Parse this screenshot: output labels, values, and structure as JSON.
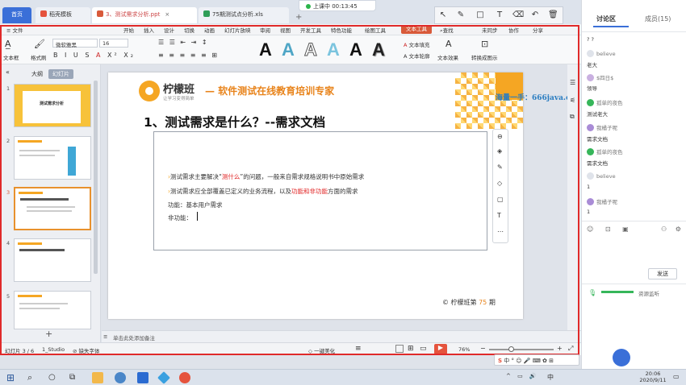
{
  "tabs": {
    "home": "首页",
    "docer": "稻壳模板",
    "ppt": "3、测试需求分析.ppt",
    "xls": "75期测试点分析.xls",
    "add": "+"
  },
  "timer": "上课中 00:13:45",
  "menu": {
    "file": "≡ 文件",
    "items": [
      "开始",
      "插入",
      "设计",
      "切换",
      "动画",
      "幻灯片放映",
      "审阅",
      "视图",
      "开发工具",
      "特色功能",
      "绘图工具",
      "文本工具"
    ],
    "search": "查找",
    "sync": "未同步",
    "collab": "协作",
    "share": "分享"
  },
  "ribbon": {
    "textbox": "文本框",
    "format_brush": "格式刷",
    "font": "微软雅黑",
    "size": "16",
    "fill": "文本填充",
    "outline": "文本轮廓",
    "effect": "文本效果",
    "convert": "转换成图示",
    "style_letter": "A"
  },
  "leftpanel": {
    "outline_tab": "大纲",
    "slides_tab": "幻灯片",
    "thumb_nums": [
      "1",
      "2",
      "3",
      "4",
      "5"
    ],
    "thumb1_title": "测试需求分析",
    "add_slide": "+"
  },
  "slide": {
    "logo": "柠檬班",
    "logo_sub": "让学习变得简单",
    "banner": "— 软件测试在线教育培训专家",
    "watermark": "海量一手：666java.com",
    "heading": "1、测试需求是什么？--需求文档",
    "bullet1_pre": "测试需求主要解决“",
    "bullet1_red": "测什么",
    "bullet1_post": "”的问题，一般来自需求规格说明书中原始需求",
    "bullet2_pre": "测试需求应全部覆盖已定义的业务流程，以及",
    "bullet2_red": "功能和非功能",
    "bullet2_post": "方面的需求",
    "line3": "功能：基本用户需求",
    "line4": "非功能：",
    "footer_pre": "© 柠檬班第",
    "footer_num": "75",
    "footer_post": "期"
  },
  "notes": "单击此处添加备注",
  "status": {
    "slide_no": "幻灯片 3 / 6",
    "theme": "1_Studio",
    "font_missing": "缺失字体",
    "beautify": "一键美化",
    "zoom": "76%"
  },
  "chat": {
    "tab_discuss": "讨论区",
    "tab_members": "成员(15)",
    "messages": [
      {
        "user": "",
        "text": "? ?"
      },
      {
        "user": "believe",
        "text": "老大"
      },
      {
        "user": "$四日$",
        "text": "领导"
      },
      {
        "user": "孤单的夜色",
        "text": "测试老大"
      },
      {
        "user": "我橘子呢",
        "text": "需求文档"
      },
      {
        "user": "孤单的夜色",
        "text": "需求文档"
      },
      {
        "user": "believe",
        "text": "1"
      },
      {
        "user": "我橘子呢",
        "text": "1"
      }
    ],
    "send": "发送",
    "footer": "资源监听"
  },
  "taskbar": {
    "time": "20:06",
    "date": "2020/9/11",
    "ime": "中"
  },
  "colors": {
    "accent": "#d85a3a",
    "brand_blue": "#3a6fd8",
    "orange": "#f5a623",
    "red_text": "#e02020",
    "rec_border": "#e02a2a"
  }
}
